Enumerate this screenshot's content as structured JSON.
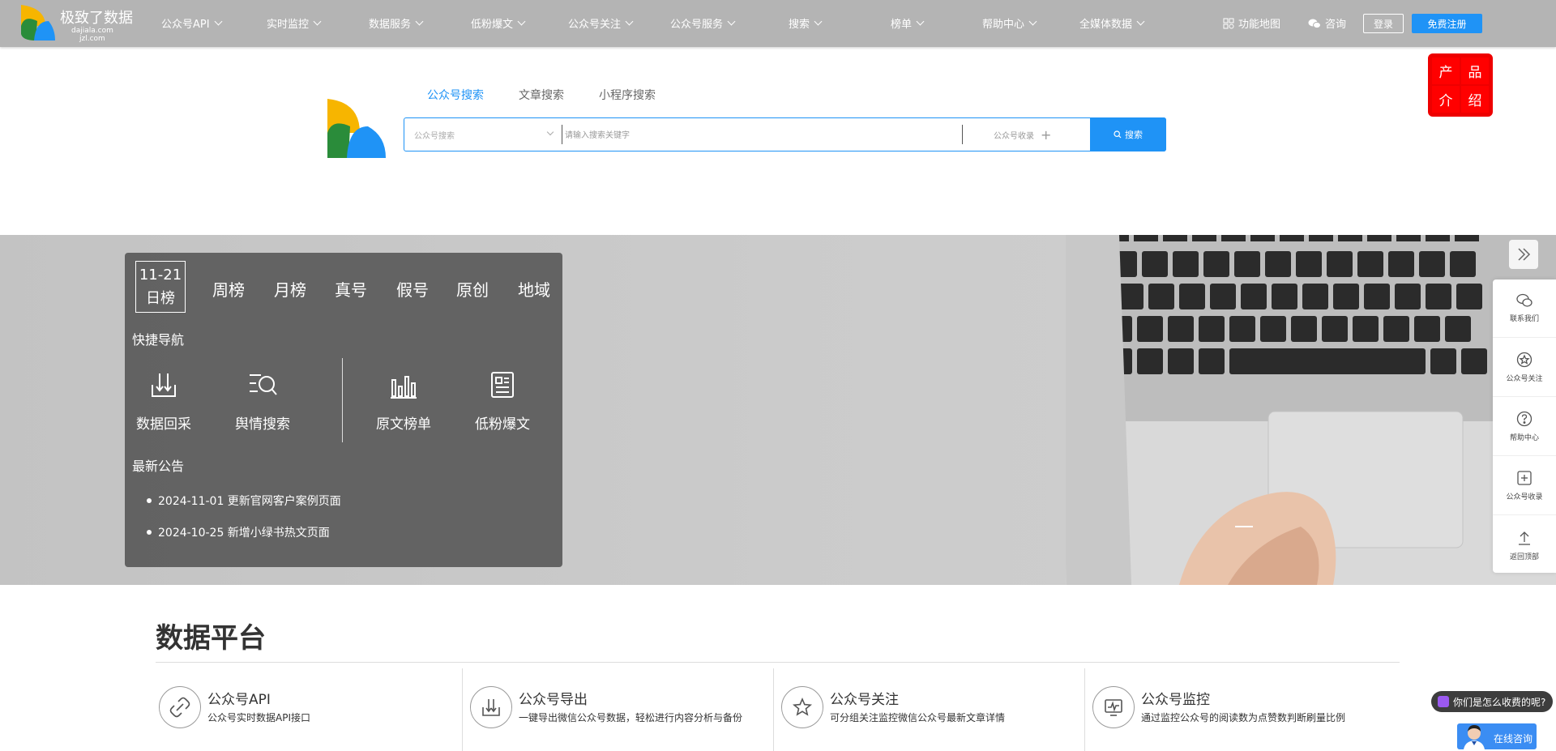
{
  "brand": {
    "name": "极致了数据",
    "domain1": "dajiala.com",
    "domain2": "jzl.com"
  },
  "nav": [
    {
      "label": "公众号API"
    },
    {
      "label": "实时监控"
    },
    {
      "label": "数据服务"
    },
    {
      "label": "低粉爆文"
    },
    {
      "label": "公众号关注"
    },
    {
      "label": "公众号服务"
    },
    {
      "label": "搜索"
    },
    {
      "label": "榜单"
    },
    {
      "label": "帮助中心"
    },
    {
      "label": "全媒体数据"
    }
  ],
  "tools": {
    "sitemap": "功能地图",
    "consult": "咨询",
    "login": "登录",
    "register": "免费注册"
  },
  "product_badge": [
    "产",
    "品",
    "介",
    "绍"
  ],
  "search": {
    "tabs": [
      "公众号搜索",
      "文章搜索",
      "小程序搜索"
    ],
    "select_placeholder": "公众号搜索",
    "input_placeholder": "请输入搜索关键字",
    "include_label": "公众号收录",
    "button": "搜索"
  },
  "panel": {
    "date": "11-21",
    "tabs": [
      "日榜",
      "周榜",
      "月榜",
      "真号",
      "假号",
      "原创",
      "地域"
    ],
    "quick_title": "快捷导航",
    "quick": [
      {
        "label": "数据回采",
        "icon": "download-tray-icon"
      },
      {
        "label": "舆情搜索",
        "icon": "search-list-icon"
      },
      {
        "label": "原文榜单",
        "icon": "bar-chart-icon"
      },
      {
        "label": "低粉爆文",
        "icon": "document-icon"
      }
    ],
    "news_title": "最新公告",
    "news": [
      "2024-11-01 更新官网客户案例页面",
      "2024-10-25 新增小绿书热文页面"
    ]
  },
  "sidebar": [
    {
      "label": "联系我们",
      "icon": "wechat-icon"
    },
    {
      "label": "公众号关注",
      "icon": "star-circle-icon"
    },
    {
      "label": "帮助中心",
      "icon": "question-icon"
    },
    {
      "label": "公众号收录",
      "icon": "plus-box-icon"
    },
    {
      "label": "返回顶部",
      "icon": "arrow-up-icon"
    }
  ],
  "platform": {
    "title": "数据平台",
    "cards": [
      {
        "title": "公众号API",
        "desc": "公众号实时数据API接口",
        "icon": "link-icon"
      },
      {
        "title": "公众号导出",
        "desc": "一键导出微信公众号数据，轻松进行内容分析与备份",
        "icon": "export-icon"
      },
      {
        "title": "公众号关注",
        "desc": "可分组关注监控微信公众号最新文章详情",
        "icon": "star-icon"
      },
      {
        "title": "公众号监控",
        "desc": "通过监控公众号的阅读数为点赞数判断刷量比例",
        "icon": "monitor-icon"
      }
    ]
  },
  "chat": {
    "bubble": "你们是怎么收费的呢?",
    "online": "在线咨询"
  },
  "colors": {
    "accent": "#1f93f6",
    "topbar": "#b4b4b4",
    "badge": "#ff0000"
  }
}
